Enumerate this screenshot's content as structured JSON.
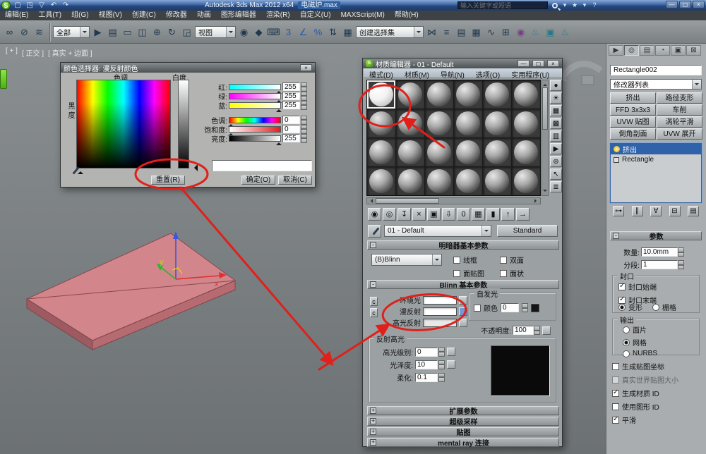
{
  "ui": {
    "plus": "+",
    "minus": "-",
    "logo_glyph": "S",
    "min_glyph": "—",
    "max_glyph": "▢",
    "close_glyph": "×"
  },
  "colors": {
    "annotation_red": "#e0201a",
    "diffuse_color": "#ffffff",
    "specular_color": "#e8e8e8",
    "object_pink": "#d2858a",
    "selection_blue": "#2f62a8"
  },
  "titlebar": {
    "app_title": "Autodesk 3ds Max  2012 x64",
    "doc_name": "电磁炉.max",
    "search_placeholder": "输入关键字或短语",
    "quick_icons": [
      {
        "n": "new-scene-icon",
        "g": "▢"
      },
      {
        "n": "open-file-icon",
        "g": "◳"
      },
      {
        "n": "save-file-icon",
        "g": "▽"
      },
      {
        "n": "undo-icon",
        "g": "↶"
      },
      {
        "n": "redo-icon",
        "g": "↷"
      }
    ],
    "right_icons": [
      {
        "n": "search-dropdown-icon",
        "g": "▾"
      },
      {
        "n": "star-icon",
        "g": "★"
      },
      {
        "n": "star-dropdown-icon",
        "g": "▾"
      },
      {
        "n": "help-icon",
        "g": "?"
      }
    ]
  },
  "menubar": {
    "items": [
      "编辑(E)",
      "工具(T)",
      "组(G)",
      "视图(V)",
      "创建(C)",
      "修改器",
      "动画",
      "图形编辑器",
      "渲染(R)",
      "自定义(U)",
      "MAXScript(M)",
      "帮助(H)"
    ]
  },
  "toolbar": {
    "selection_filter": "全部",
    "coord_system": "视图",
    "named_sets": "创建选择集",
    "group1": [
      {
        "n": "select-and-link-icon",
        "g": "∞",
        "c": ""
      },
      {
        "n": "unlink-selection-icon",
        "g": "⊘",
        "c": ""
      },
      {
        "n": "bind-to-spacewarp-icon",
        "g": "≋",
        "c": ""
      }
    ],
    "group2": [
      {
        "n": "select-object-icon",
        "g": "▶",
        "c": ""
      },
      {
        "n": "select-by-name-icon",
        "g": "▤",
        "c": ""
      },
      {
        "n": "rect-selection-region-icon",
        "g": "▭",
        "c": ""
      },
      {
        "n": "window-crossing-icon",
        "g": "◫",
        "c": ""
      },
      {
        "n": "select-move-icon",
        "g": "⊕",
        "c": ""
      },
      {
        "n": "select-rotate-icon",
        "g": "↻",
        "c": ""
      },
      {
        "n": "select-scale-icon",
        "g": "◲",
        "c": ""
      }
    ],
    "group3": [
      {
        "n": "use-pivot-center-icon",
        "g": "◉",
        "c": ""
      },
      {
        "n": "select-manipulate-icon",
        "g": "◆",
        "c": ""
      },
      {
        "n": "keyboard-override-icon",
        "g": "⌨",
        "c": ""
      },
      {
        "n": "snap-toggle-3d-icon",
        "g": "3",
        "c": "ic-blue"
      },
      {
        "n": "angle-snap-icon",
        "g": "∠",
        "c": "ic-blue"
      },
      {
        "n": "percent-snap-icon",
        "g": "%",
        "c": "ic-blue"
      },
      {
        "n": "spinner-snap-icon",
        "g": "⇅",
        "c": ""
      },
      {
        "n": "edit-named-sets-icon",
        "g": "▦",
        "c": ""
      }
    ],
    "group4": [
      {
        "n": "mirror-icon",
        "g": "⋈",
        "c": ""
      },
      {
        "n": "align-icon",
        "g": "≡",
        "c": ""
      },
      {
        "n": "layer-manager-icon",
        "g": "▤",
        "c": ""
      },
      {
        "n": "graphite-ribbon-icon",
        "g": "▦",
        "c": ""
      },
      {
        "n": "curve-editor-icon",
        "g": "∿",
        "c": ""
      },
      {
        "n": "schematic-view-icon",
        "g": "⊞",
        "c": ""
      },
      {
        "n": "material-editor-icon",
        "g": "◉",
        "c": "ic-purple"
      },
      {
        "n": "render-setup-icon",
        "g": "♨",
        "c": "ic-teal"
      },
      {
        "n": "rendered-frame-icon",
        "g": "▣",
        "c": "ic-teal"
      },
      {
        "n": "render-production-icon",
        "g": "♨",
        "c": "ic-teal"
      }
    ]
  },
  "viewport": {
    "label_menu": "[ + ]",
    "label_view": "[ 正交 ]",
    "label_shading": "[ 真实 + 边面 ]",
    "axis_x": "x",
    "axis_y": "y"
  },
  "color_picker": {
    "title": "颜色选择器: 漫反射颜色",
    "hue_label": "色调",
    "whiteness_label": "白度",
    "blackness_label": "黑度",
    "channels": [
      {
        "label": "红:",
        "value": "255",
        "bar": "bar-red",
        "pos": "pos-right"
      },
      {
        "label": "绿:",
        "value": "255",
        "bar": "bar-green",
        "pos": "pos-right"
      },
      {
        "label": "蓝:",
        "value": "255",
        "bar": "bar-blue",
        "pos": "pos-right"
      },
      {
        "label": "色调:",
        "value": "0",
        "bar": "bar-hue",
        "pos": "pos-left"
      },
      {
        "label": "饱和度:",
        "value": "0",
        "bar": "bar-sat",
        "pos": "pos-left"
      },
      {
        "label": "亮度:",
        "value": "255",
        "bar": "bar-lum",
        "pos": "pos-right"
      }
    ],
    "reset_button": "重置(R)",
    "ok_button": "确定(O)",
    "cancel_button": "取消(C)"
  },
  "material_editor": {
    "title": "材质编辑器 - 01 - Default",
    "menu_items": [
      "模式(D)",
      "材质(M)",
      "导航(N)",
      "选项(O)",
      "实用程序(U)"
    ],
    "slot_count": 24,
    "side_icons": [
      {
        "n": "sample-type-icon",
        "g": "●"
      },
      {
        "n": "backlight-icon",
        "g": "☀"
      },
      {
        "n": "background-icon",
        "g": "▦"
      },
      {
        "n": "sample-uv-tiling-icon",
        "g": "▩"
      },
      {
        "n": "video-color-check-icon",
        "g": "▥"
      },
      {
        "n": "make-preview-icon",
        "g": "▶"
      },
      {
        "n": "options-icon",
        "g": "⊛"
      },
      {
        "n": "select-by-material-icon",
        "g": "↖"
      },
      {
        "n": "material-map-navigator-icon",
        "g": "≣"
      }
    ],
    "tool_icons": [
      {
        "n": "get-material-icon",
        "g": "◉",
        "c": ""
      },
      {
        "n": "put-material-icon",
        "g": "◎",
        "c": ""
      },
      {
        "n": "assign-material-icon",
        "g": "↧",
        "c": ""
      },
      {
        "n": "reset-map-icon",
        "g": "×",
        "c": "ic-red"
      },
      {
        "n": "make-copy-icon",
        "g": "▣",
        "c": ""
      },
      {
        "n": "put-to-library-icon",
        "g": "⇩",
        "c": ""
      },
      {
        "n": "material-id-icon",
        "g": "0",
        "c": ""
      },
      {
        "n": "show-map-viewport-icon",
        "g": "▦",
        "c": "ic-blue"
      },
      {
        "n": "show-end-result-icon",
        "g": "▮",
        "c": ""
      },
      {
        "n": "go-parent-icon",
        "g": "↑",
        "c": ""
      },
      {
        "n": "go-sibling-icon",
        "g": "→",
        "c": ""
      }
    ],
    "material_name": "01 - Default",
    "material_type": "Standard",
    "shader_rollout_title": "明暗器基本参数",
    "shader_type": "(B)Blinn",
    "shader_checkboxes": [
      {
        "label": "线框",
        "state": ""
      },
      {
        "label": "双面",
        "state": ""
      },
      {
        "label": "面贴图",
        "state": ""
      },
      {
        "label": "面状",
        "state": ""
      }
    ],
    "blinn_rollout_title": "Blinn 基本参数",
    "color_rows": [
      {
        "label": "环境光",
        "sw": "sw-white",
        "mapc": ""
      },
      {
        "label": "漫反射",
        "sw": "sw-white",
        "mapc": "blue-map"
      },
      {
        "label": "高光反射",
        "sw": "sw-light",
        "mapc": ""
      }
    ],
    "selfillum_label": "自发光",
    "selfillum_color_label": "颜色",
    "selfillum_value": "0",
    "opacity_label": "不透明度:",
    "opacity_value": "100",
    "highlight_group_label": "反射高光",
    "highlight_rows": [
      {
        "label": "高光级别:",
        "value": "0",
        "mapc": ""
      },
      {
        "label": "光泽度:",
        "value": "10",
        "mapc": ""
      },
      {
        "label": "柔化:",
        "value": "0.1",
        "mapc": "hidden"
      }
    ],
    "collapsed_rollouts": [
      {
        "label": "扩展参数"
      },
      {
        "label": "超级采样"
      },
      {
        "label": "贴图"
      },
      {
        "label": "mental ray 连接"
      }
    ]
  },
  "command_panel": {
    "tabs": [
      {
        "n": "tab-create-icon",
        "g": "▶",
        "cls": ""
      },
      {
        "n": "tab-modify-icon",
        "g": "◎",
        "cls": "active"
      },
      {
        "n": "tab-hierarchy-icon",
        "g": "▤",
        "cls": ""
      },
      {
        "n": "tab-motion-icon",
        "g": "◔",
        "cls": ""
      },
      {
        "n": "tab-display-icon",
        "g": "▣",
        "cls": ""
      },
      {
        "n": "tab-utilities-icon",
        "g": "⊠",
        "cls": ""
      }
    ],
    "object_name": "Rectangle002",
    "modifier_list_label": "修改器列表",
    "modifier_buttons": [
      "挤出",
      "路径变形",
      "FFD 3x3x3",
      "车削",
      "UVW 贴图",
      "涡轮平滑",
      "倒角剖面",
      "UVW 展开"
    ],
    "stack_rows": [
      {
        "label": "挤出",
        "cls": "sel",
        "icon": "bulb"
      },
      {
        "label": "Rectangle",
        "cls": "",
        "icon": "shape"
      }
    ],
    "stack_tools": [
      {
        "n": "pin-stack-icon",
        "g": "⊶"
      },
      {
        "n": "show-end-result-stack-icon",
        "g": "∥"
      },
      {
        "n": "make-unique-icon",
        "g": "∀"
      },
      {
        "n": "remove-modifier-icon",
        "g": "⊟"
      },
      {
        "n": "configure-modifier-sets-icon",
        "g": "▤"
      }
    ],
    "params_rollout_title": "参数",
    "amount_label": "数量:",
    "amount_value": "10.0mm",
    "segments_label": "分段:",
    "segments_value": "1",
    "cap_group_label": "封口",
    "cap_checks": [
      {
        "label": "封口始端",
        "state": "checked"
      },
      {
        "label": "封口末端",
        "state": "checked"
      }
    ],
    "cap_radios": [
      {
        "label": "变形",
        "state": "sel"
      },
      {
        "label": "栅格",
        "state": ""
      }
    ],
    "output_group_label": "输出",
    "output_radios": [
      {
        "label": "面片",
        "state": ""
      },
      {
        "label": "网格",
        "state": "sel"
      },
      {
        "label": "NURBS",
        "state": ""
      }
    ],
    "bottom_checks": [
      {
        "label": "生成贴图坐标",
        "state": "",
        "extra": ""
      },
      {
        "label": "真实世界贴图大小",
        "state": "",
        "extra": "disabled"
      },
      {
        "label": "生成材质 ID",
        "state": "checked",
        "extra": ""
      },
      {
        "label": "使用图形 ID",
        "state": "",
        "extra": ""
      },
      {
        "label": "平滑",
        "state": "checked",
        "extra": ""
      }
    ]
  }
}
